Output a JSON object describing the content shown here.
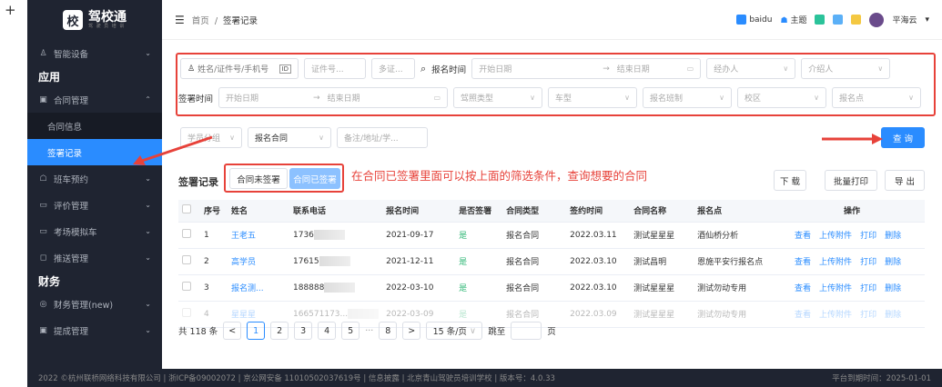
{
  "plus": "+",
  "app": {
    "logo_mark": "校",
    "name": "驾校通",
    "sub": "驾 驶 员 培 训"
  },
  "sidebar": {
    "items": [
      {
        "label": "智能设备",
        "icon": "♙"
      },
      {
        "section": "应用"
      },
      {
        "label": "合同管理",
        "icon": "▣",
        "open": true
      },
      {
        "sub": "合同信息"
      },
      {
        "sub": "签署记录",
        "active": true
      },
      {
        "label": "班车预约",
        "icon": "☖"
      },
      {
        "label": "评价管理",
        "icon": "▭"
      },
      {
        "label": "考场模拟车",
        "icon": "▭"
      },
      {
        "label": "推送管理",
        "icon": "◻"
      },
      {
        "section": "财务"
      },
      {
        "label": "财务管理(new)",
        "icon": "◎"
      },
      {
        "label": "提成管理",
        "icon": "▣"
      }
    ]
  },
  "header": {
    "menu_icon": "☰",
    "crumb_home": "首页",
    "crumb_sep": "/",
    "crumb_current": "签署记录",
    "baidu": "baidu",
    "theme": "主题",
    "user": "平海云"
  },
  "filters": {
    "search_placeholder": "姓名/证件号/手机号",
    "id_placeholder": "证件号...",
    "id_type": "多证...",
    "signup_time_label": "报名时间",
    "start_date": "开始日期",
    "arrow": "→",
    "end_date": "结束日期",
    "handler": "经办人",
    "referrer": "介绍人",
    "sign_time_label": "签署时间",
    "license_type": "驾照类型",
    "car_type": "车型",
    "class_type": "报名班制",
    "campus": "校区",
    "signup_point": "报名点",
    "student_group": "学员分组",
    "contract_type_value": "报名合同",
    "remark_placeholder": "备注/地址/学...",
    "query_button": "查 询"
  },
  "records": {
    "title": "签署记录",
    "tab_unsigned": "合同未签署",
    "tab_signed": "合同已签署",
    "annotation": "在合同已签署里面可以按上面的筛选条件，查询想要的合同",
    "download": "下 载",
    "batch_print": "批量打印",
    "export": "导 出"
  },
  "table": {
    "headers": [
      "序号",
      "姓名",
      "联系电话",
      "报名时间",
      "是否签署",
      "合同类型",
      "签约时间",
      "合同名称",
      "报名点",
      "操作"
    ],
    "rows": [
      {
        "no": "1",
        "name": "王老五",
        "phone": "1736",
        "date": "2021-09-17",
        "signed": "是",
        "type": "报名合同",
        "sign_date": "2022.03.11",
        "contract": "测试星星星",
        "point": "酒仙桥分析"
      },
      {
        "no": "2",
        "name": "高学员",
        "phone": "17615",
        "date": "2021-12-11",
        "signed": "是",
        "type": "报名合同",
        "sign_date": "2022.03.10",
        "contract": "测试昌明",
        "point": "恩施平安行报名点"
      },
      {
        "no": "3",
        "name": "报名测...",
        "phone": "188888",
        "date": "2022-03-10",
        "signed": "是",
        "type": "报名合同",
        "sign_date": "2022.03.10",
        "contract": "测试星星星",
        "point": "测试勿动专用"
      },
      {
        "no": "4",
        "name": "星星星",
        "phone": "166571173...",
        "date": "2022-03-09",
        "signed": "是",
        "type": "报名合同",
        "sign_date": "2022.03.09",
        "contract": "测试星星星",
        "point": "测试勿动专用"
      }
    ],
    "ops": [
      "查看",
      "上传附件",
      "打印",
      "删除"
    ]
  },
  "pagination": {
    "total": "共 118 条",
    "prev": "<",
    "pages": [
      "1",
      "2",
      "3",
      "4",
      "5"
    ],
    "dots": "···",
    "last": "8",
    "next": ">",
    "size": "15 条/页",
    "goto": "跳至",
    "page_unit": "页"
  },
  "footer": {
    "left": "2022 ©杭州联桥网络科技有限公司 | 浙ICP备09002072 | 京公网安备 11010502037619号 | 信息披露 | 北京青山驾驶员培训学校 | 版本号：4.0.33",
    "right": "平台到期时间：2025-01-01"
  }
}
